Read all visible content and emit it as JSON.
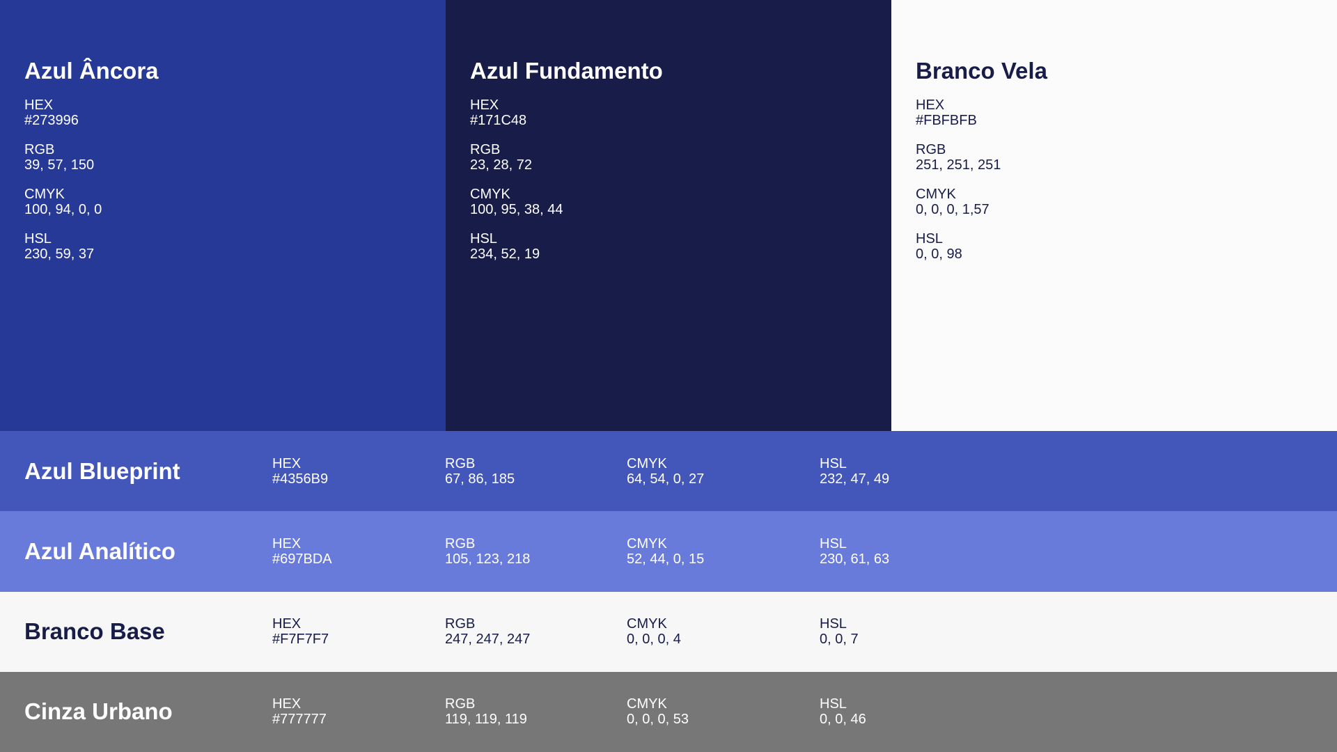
{
  "top_swatches": [
    {
      "name": "Azul Âncora",
      "bg": "#273996",
      "fg": "#FFFFFF",
      "hex_label": "HEX",
      "hex": "#273996",
      "rgb_label": "RGB",
      "rgb": "39, 57, 150",
      "cmyk_label": "CMYK",
      "cmyk": "100, 94, 0, 0",
      "hsl_label": "HSL",
      "hsl": "230, 59, 37"
    },
    {
      "name": "Azul Fundamento",
      "bg": "#171C48",
      "fg": "#FFFFFF",
      "hex_label": "HEX",
      "hex": "#171C48",
      "rgb_label": "RGB",
      "rgb": "23, 28, 72",
      "cmyk_label": "CMYK",
      "cmyk": "100, 95, 38, 44",
      "hsl_label": "HSL",
      "hsl": "234, 52, 19"
    },
    {
      "name": "Branco Vela",
      "bg": "#FBFBFB",
      "fg": "#171C48",
      "hex_label": "HEX",
      "hex": "#FBFBFB",
      "rgb_label": "RGB",
      "rgb": "251, 251, 251",
      "cmyk_label": "CMYK",
      "cmyk": "0, 0, 0, 1,57",
      "hsl_label": "HSL",
      "hsl": "0, 0, 98"
    }
  ],
  "rows": [
    {
      "name": "Azul Blueprint",
      "bg": "#4356B9",
      "fg": "#FFFFFF",
      "hex_label": "HEX",
      "hex": "#4356B9",
      "rgb_label": "RGB",
      "rgb": "67, 86, 185",
      "cmyk_label": "CMYK",
      "cmyk": "64, 54, 0, 27",
      "hsl_label": "HSL",
      "hsl": "232, 47, 49"
    },
    {
      "name": "Azul Analítico",
      "bg": "#697BDA",
      "fg": "#FFFFFF",
      "hex_label": "HEX",
      "hex": "#697BDA",
      "rgb_label": "RGB",
      "rgb": "105, 123, 218",
      "cmyk_label": "CMYK",
      "cmyk": "52, 44, 0, 15",
      "hsl_label": "HSL",
      "hsl": "230, 61, 63"
    },
    {
      "name": "Branco Base",
      "bg": "#F7F7F7",
      "fg": "#171C48",
      "hex_label": "HEX",
      "hex": "#F7F7F7",
      "rgb_label": "RGB",
      "rgb": "247, 247, 247",
      "cmyk_label": "CMYK",
      "cmyk": "0, 0, 0, 4",
      "hsl_label": "HSL",
      "hsl": "0, 0, 7"
    },
    {
      "name": "Cinza Urbano",
      "bg": "#777777",
      "fg": "#FFFFFF",
      "hex_label": "HEX",
      "hex": "#777777",
      "rgb_label": "RGB",
      "rgb": "119, 119, 119",
      "cmyk_label": "CMYK",
      "cmyk": "0, 0, 0, 53",
      "hsl_label": "HSL",
      "hsl": "0, 0, 46"
    }
  ]
}
